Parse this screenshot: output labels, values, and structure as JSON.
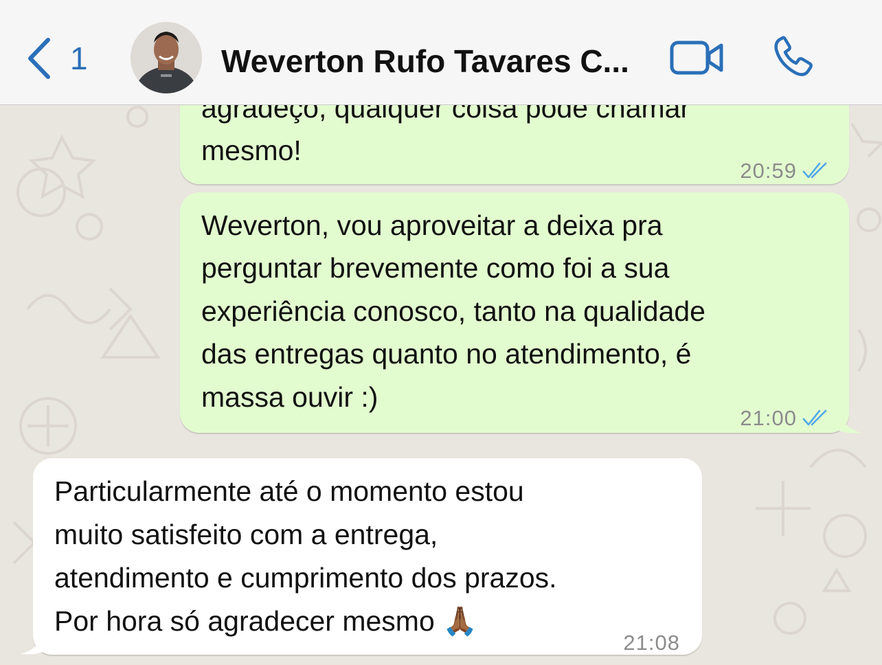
{
  "header": {
    "back_count": "1",
    "contact_name": "Weverton Rufo Tavares C...",
    "icons": [
      "chevron-left-icon",
      "video-call-icon",
      "phone-icon"
    ],
    "accent_color": "#2a6fb8"
  },
  "messages": [
    {
      "direction": "outgoing",
      "lines": [
        "agradeço, qualquer coisa pode chamar",
        "mesmo!"
      ],
      "time": "20:59",
      "status": "read"
    },
    {
      "direction": "outgoing",
      "lines": [
        "Weverton, vou aproveitar a deixa pra",
        "perguntar brevemente como foi a sua",
        "experiência conosco, tanto na qualidade",
        "das entregas quanto no atendimento, é",
        "massa ouvir :)"
      ],
      "time": "21:00",
      "status": "read"
    },
    {
      "direction": "incoming",
      "lines": [
        "Particularmente até o momento estou",
        "muito satisfeito com a entrega,",
        "atendimento e cumprimento dos prazos.",
        "Por hora só agradecer mesmo 🙏🏾"
      ],
      "time": "21:08"
    }
  ],
  "colors": {
    "outgoing_bubble": "#e2fccf",
    "incoming_bubble": "#ffffff",
    "read_ticks": "#4fa7e8"
  }
}
